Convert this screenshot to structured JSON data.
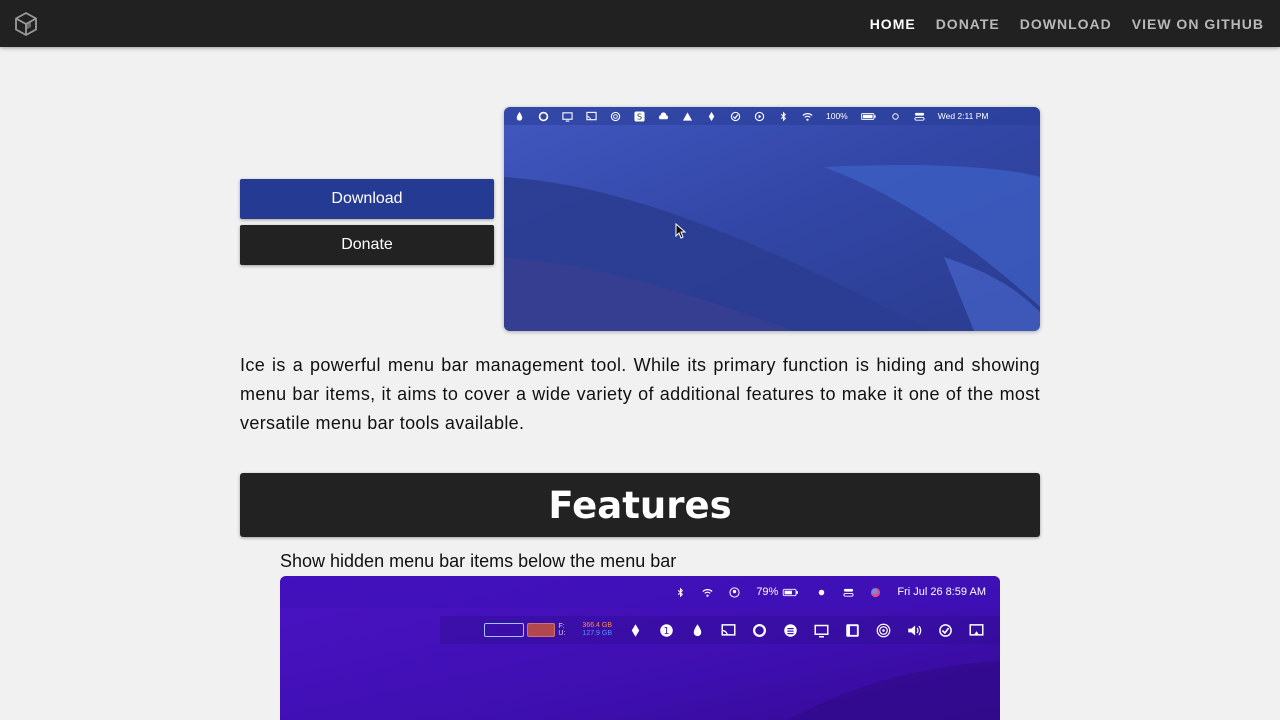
{
  "nav": {
    "links": [
      "HOME",
      "DONATE",
      "DOWNLOAD",
      "VIEW ON GITHUB"
    ],
    "logo_icon": "cube-logo-icon"
  },
  "hero": {
    "download_label": "Download",
    "donate_label": "Donate",
    "screenshot": {
      "battery": "100%",
      "clock": "Wed 2:11 PM"
    }
  },
  "intro": "Ice is a powerful menu bar management tool. While its primary function is hiding and showing menu bar items, it aims to cover a wide variety of additional features to make it one of the most versatile menu bar tools available.",
  "features": {
    "title": "Features",
    "items": [
      {
        "caption": "Show hidden menu bar items below the menu bar",
        "screenshot": {
          "battery": "79%",
          "clock": "Fri Jul 26  8:59 AM",
          "disk_a": "366.4 GB",
          "disk_b": "127.9 GB",
          "meter_labels": [
            "F:",
            "U:"
          ]
        }
      }
    ]
  },
  "colors": {
    "nav_bg": "#212121",
    "download_btn": "#253a93",
    "donate_btn": "#222222",
    "features_bar": "#222222",
    "page_bg": "#f1f1f1"
  }
}
